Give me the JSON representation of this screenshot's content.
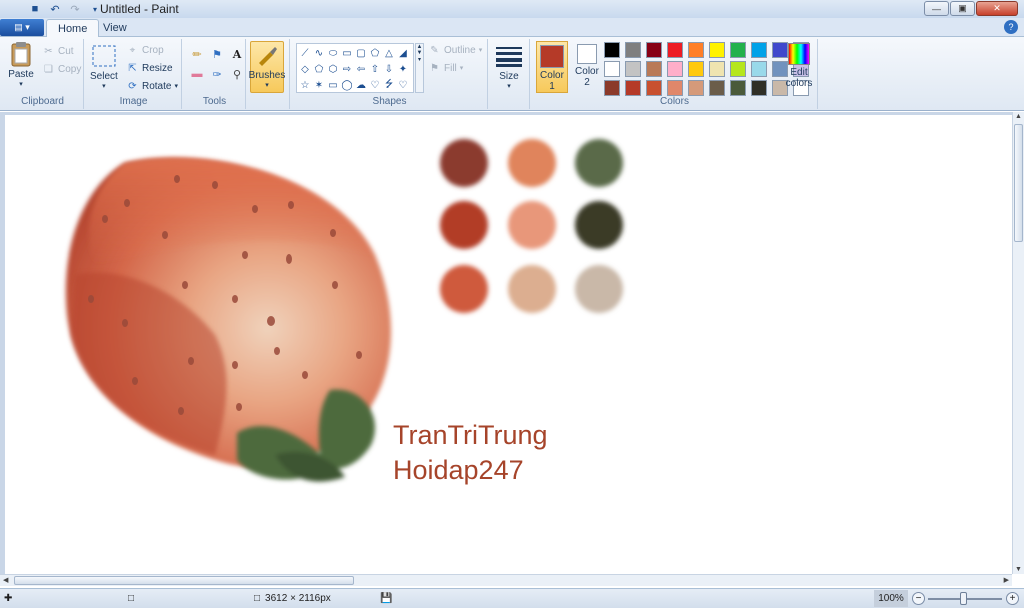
{
  "window": {
    "title": "Untitled - Paint"
  },
  "tabs": [
    {
      "label": "Home",
      "active": true
    },
    {
      "label": "View",
      "active": false
    }
  ],
  "ribbon": {
    "clipboard": {
      "group_label": "Clipboard",
      "paste": "Paste",
      "cut": "Cut",
      "copy": "Copy"
    },
    "image": {
      "group_label": "Image",
      "select": "Select",
      "crop": "Crop",
      "resize": "Resize",
      "rotate": "Rotate"
    },
    "tools": {
      "group_label": "Tools"
    },
    "brushes": {
      "label": "Brushes"
    },
    "shapes": {
      "group_label": "Shapes",
      "outline": "Outline",
      "fill": "Fill"
    },
    "size": {
      "label": "Size"
    },
    "colors": {
      "group_label": "Colors",
      "color1_label": "Color",
      "color1_num": "1",
      "color2_label": "Color",
      "color2_num": "2",
      "color1_value": "#b53a28",
      "color2_value": "#ffffff",
      "edit_label": "Edit",
      "edit_label2": "colors",
      "palette": [
        "#000000",
        "#7f7f7f",
        "#880015",
        "#ed1c24",
        "#ff7f27",
        "#fff200",
        "#22b14c",
        "#00a2e8",
        "#3f48cc",
        "#a349a4",
        "#ffffff",
        "#c3c3c3",
        "#b97a57",
        "#ffaec9",
        "#ffc90e",
        "#efe4b0",
        "#b5e61d",
        "#99d9ea",
        "#7092be",
        "#c8bfe7",
        "#8b3a2a",
        "#b53a28",
        "#c8502f",
        "#e0876a",
        "#d59a7a",
        "#6b5d4a",
        "#4a5a3a",
        "#2f2f26",
        "#c9b8a8",
        "#ffffff"
      ]
    }
  },
  "canvas": {
    "text_line1": "TranTriTrung",
    "text_line2": "Hoidap247",
    "dots": [
      "#8b3a2e",
      "#e0845c",
      "#5a6b4a",
      "#b23c28",
      "#e8977a",
      "#3b3a28",
      "#cf5a3c",
      "#dcae90",
      "#c9b8a8"
    ]
  },
  "status": {
    "dimensions": "3612 × 2116px",
    "zoom": "100%"
  }
}
